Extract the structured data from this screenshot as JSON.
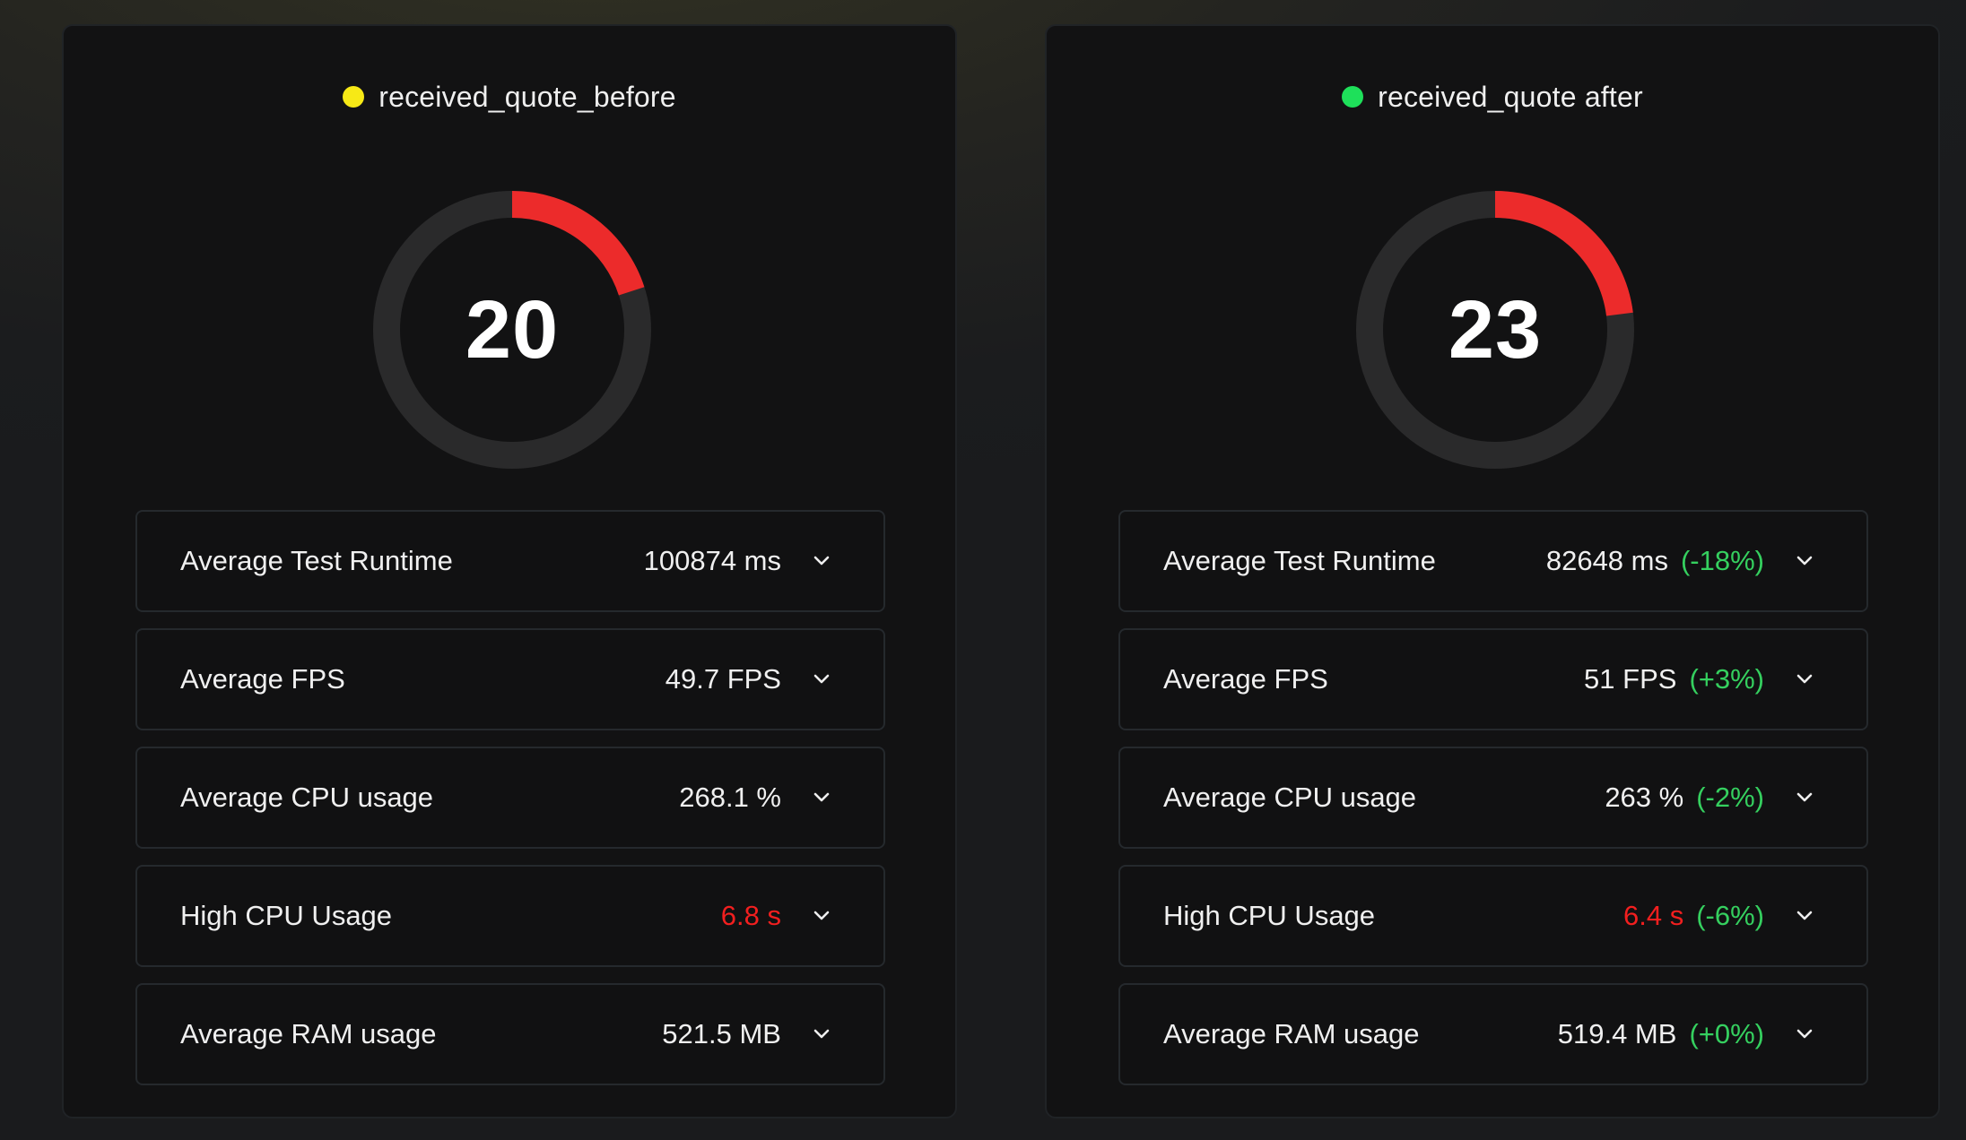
{
  "colors": {
    "accent_red": "#ec2b2b",
    "track": "#2a2a2b",
    "dot_before": "#f7e916",
    "dot_after": "#1ee05a",
    "delta_green": "#35d05f",
    "value_red": "#f21f1f"
  },
  "panels": [
    {
      "title": "received_quote_before",
      "score": "20",
      "score_fraction": 0.2,
      "metrics": [
        {
          "label": "Average Test Runtime",
          "value": "100874 ms",
          "delta": ""
        },
        {
          "label": "Average FPS",
          "value": "49.7 FPS",
          "delta": ""
        },
        {
          "label": "Average CPU usage",
          "value": "268.1 %",
          "delta": ""
        },
        {
          "label": "High CPU Usage",
          "value": "6.8 s",
          "delta": ""
        },
        {
          "label": "Average RAM usage",
          "value": "521.5 MB",
          "delta": ""
        }
      ]
    },
    {
      "title": "received_quote after",
      "score": "23",
      "score_fraction": 0.23,
      "metrics": [
        {
          "label": "Average Test Runtime",
          "value": "82648 ms",
          "delta": "(-18%)"
        },
        {
          "label": "Average FPS",
          "value": "51 FPS",
          "delta": "(+3%)"
        },
        {
          "label": "Average CPU usage",
          "value": "263 %",
          "delta": "(-2%)"
        },
        {
          "label": "High CPU Usage",
          "value": "6.4 s",
          "delta": "(-6%)"
        },
        {
          "label": "Average RAM usage",
          "value": "519.4 MB",
          "delta": "(+0%)"
        }
      ]
    }
  ],
  "icons": {
    "status_dot": "status-dot-icon",
    "expand": "chevron-down-icon"
  }
}
